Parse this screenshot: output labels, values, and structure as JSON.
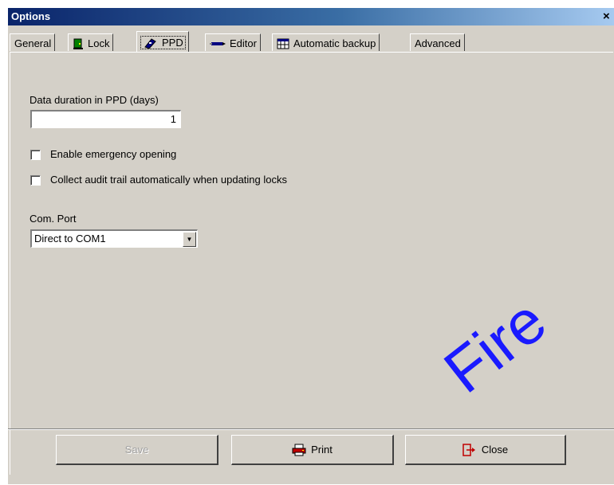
{
  "window": {
    "title": "Options",
    "close_glyph": "×"
  },
  "tabs": [
    {
      "label": "General",
      "icon": null,
      "active": false
    },
    {
      "label": "Lock",
      "icon": "lock-icon",
      "active": false
    },
    {
      "label": "PPD",
      "icon": "ppd-icon",
      "active": true
    },
    {
      "label": "Editor",
      "icon": "editor-icon",
      "active": false
    },
    {
      "label": "Automatic backup",
      "icon": "automatic-backup-icon",
      "active": false
    },
    {
      "label": "Advanced",
      "icon": null,
      "active": false
    }
  ],
  "ppd": {
    "duration_label": "Data duration in PPD (days)",
    "duration_value": "1",
    "emergency_label": "Enable emergency opening",
    "emergency_checked": false,
    "audit_label": "Collect audit trail automatically when updating locks",
    "audit_checked": false,
    "port_label": "Com. Port",
    "port_value": "Direct to COM1"
  },
  "buttons": {
    "save": "Save",
    "print": "Print",
    "close": "Close",
    "save_enabled": false
  },
  "watermark": "Fire",
  "colors": {
    "titlebar": "#0a246a",
    "face": "#d4d0c8",
    "watermark": "#1a1aff"
  }
}
